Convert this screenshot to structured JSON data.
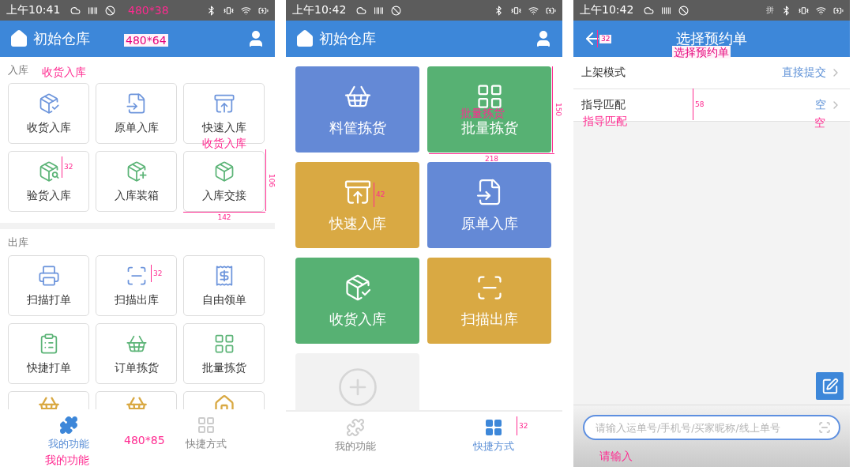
{
  "screens": [
    {
      "kind": "function_grid",
      "status_bar": {
        "time": "上午10:41"
      },
      "header": {
        "title": "初始仓库"
      },
      "sections": [
        {
          "title": "入库",
          "items": [
            {
              "label": "收货入库",
              "color": "#6d95dc"
            },
            {
              "label": "原单入库",
              "color": "#6d95dc"
            },
            {
              "label": "快速入库",
              "color": "#6d95dc"
            },
            {
              "label": "验货入库",
              "color": "#5cb477"
            },
            {
              "label": "入库装箱",
              "color": "#5cb477"
            },
            {
              "label": "入库交接",
              "color": "#5cb477"
            }
          ]
        },
        {
          "title": "出库",
          "items": [
            {
              "label": "扫描打单",
              "color": "#6d95dc"
            },
            {
              "label": "扫描出库",
              "color": "#6d95dc"
            },
            {
              "label": "自由领单",
              "color": "#6d95dc"
            },
            {
              "label": "快捷打单",
              "color": "#5cb477"
            },
            {
              "label": "订单拣货",
              "color": "#5cb477"
            },
            {
              "label": "批量拣货",
              "color": "#5cb477"
            },
            {
              "color": "#d9a943"
            },
            {
              "color": "#d9a943"
            },
            {
              "color": "#d9a943"
            }
          ]
        }
      ],
      "bottom_nav": [
        {
          "label": "我的功能",
          "selected": true
        },
        {
          "label": "快捷方式",
          "selected": false
        }
      ],
      "annotations": [
        {
          "kind": "label",
          "text": "480*38"
        },
        {
          "kind": "label",
          "text": "480*64"
        },
        {
          "kind": "label",
          "text": "收货入库"
        },
        {
          "kind": "label",
          "text": "收货入库"
        },
        {
          "kind": "vertical",
          "text": "32"
        },
        {
          "kind": "vertical",
          "text": "106"
        },
        {
          "kind": "horizontal",
          "text": "142"
        },
        {
          "kind": "vertical",
          "text": "32"
        },
        {
          "kind": "label",
          "text": "480*85"
        },
        {
          "kind": "label",
          "text": "我的功能"
        }
      ]
    },
    {
      "kind": "shortcut_tiles",
      "status_bar": {
        "time": "上午10:42"
      },
      "header": {
        "title": "初始仓库"
      },
      "tiles": [
        {
          "kind": "shortcut",
          "label": "料筐拣货",
          "color": "#6489d6"
        },
        {
          "kind": "shortcut",
          "label": "批量拣货",
          "color": "#57b173"
        },
        {
          "kind": "shortcut",
          "label": "快速入库",
          "color": "#d9a943"
        },
        {
          "kind": "shortcut",
          "label": "原单入库",
          "color": "#6489d6"
        },
        {
          "kind": "shortcut",
          "label": "收货入库",
          "color": "#57b173"
        },
        {
          "kind": "shortcut",
          "label": "扫描出库",
          "color": "#d9a943"
        },
        {
          "kind": "add",
          "color": "#f2f2f2"
        }
      ],
      "bottom_nav": [
        {
          "label": "我的功能",
          "selected": false
        },
        {
          "label": "快捷方式",
          "selected": true
        }
      ],
      "annotations": [
        {
          "kind": "label",
          "text": "批量拣货"
        },
        {
          "kind": "vertical",
          "text": "150"
        },
        {
          "kind": "horizontal",
          "text": "218"
        },
        {
          "kind": "vertical",
          "text": "42"
        },
        {
          "kind": "vertical",
          "text": "32"
        }
      ]
    },
    {
      "kind": "form",
      "status_bar": {
        "time": "上午10:42",
        "input_indicator": "拼"
      },
      "header": {
        "title": "选择预约单"
      },
      "rows": [
        {
          "label": "上架模式",
          "value": "直接提交"
        },
        {
          "label": "指导匹配",
          "value": "空"
        }
      ],
      "search": {
        "placeholder": "请输入运单号/手机号/买家昵称/线上单号"
      },
      "annotations": [
        {
          "kind": "vertical",
          "text": "32"
        },
        {
          "kind": "label",
          "text": "选择预约单"
        },
        {
          "kind": "vertical",
          "text": "58"
        },
        {
          "kind": "label",
          "text": "指导匹配"
        },
        {
          "kind": "label",
          "text": "空"
        },
        {
          "kind": "label",
          "text": "请输入"
        }
      ]
    }
  ]
}
